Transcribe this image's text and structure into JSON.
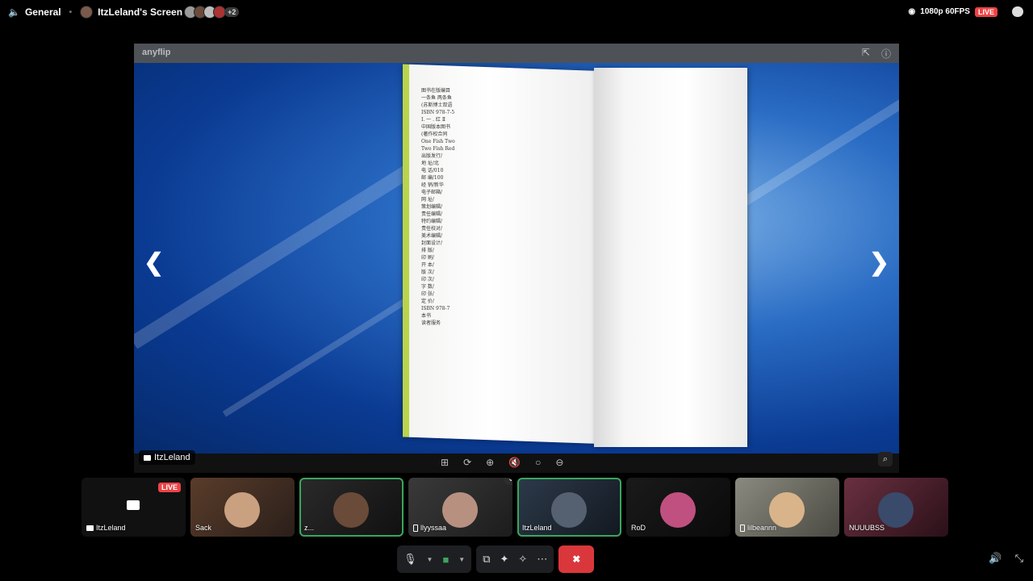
{
  "top": {
    "channel": "General",
    "screen_title": "ItzLeland's Screen",
    "more_viewers": "+2",
    "quality": "1080p 60FPS",
    "live": "LIVE"
  },
  "viewer": {
    "logo": "anyflip",
    "owner": "ItzLeland",
    "page_lines": [
      "图书在版编目",
      "一条鱼 两条鱼",
      "(苏斯博士双语",
      "ISBN 978-7-5",
      "I. 一 . 红 Ⅱ",
      "中国版本图书",
      "(著作权合同",
      "One Fish Two",
      "Two Fish Red",
      "出版发行/",
      "地 址/北",
      "电 话/010",
      "邮 编/100",
      "经 销/新华",
      "电子邮箱/",
      "网 址/",
      "策划编辑/",
      "责任编辑/",
      "特约编辑/",
      "责任校对/",
      "美术编辑/",
      "封面设计/",
      "排 版/",
      "印 刷/",
      "开 本/",
      "版 次/",
      "印 次/",
      "字 数/",
      "印 张/",
      "定 价/",
      "ISBN 978-7",
      "本书",
      "读者服务"
    ]
  },
  "tiles": [
    {
      "name": "ItzLeland",
      "live": "LIVE"
    },
    {
      "name": "Sack"
    },
    {
      "name": "z..."
    },
    {
      "name": "llyyssaa"
    },
    {
      "name": "ItzLeland"
    },
    {
      "name": "RoD"
    },
    {
      "name": "lilbeannn"
    },
    {
      "name": "NUUUBSS"
    }
  ],
  "colors": {
    "accent_green": "#3ba55d",
    "live_red": "#ed4245",
    "end_call_red": "#da373c"
  }
}
